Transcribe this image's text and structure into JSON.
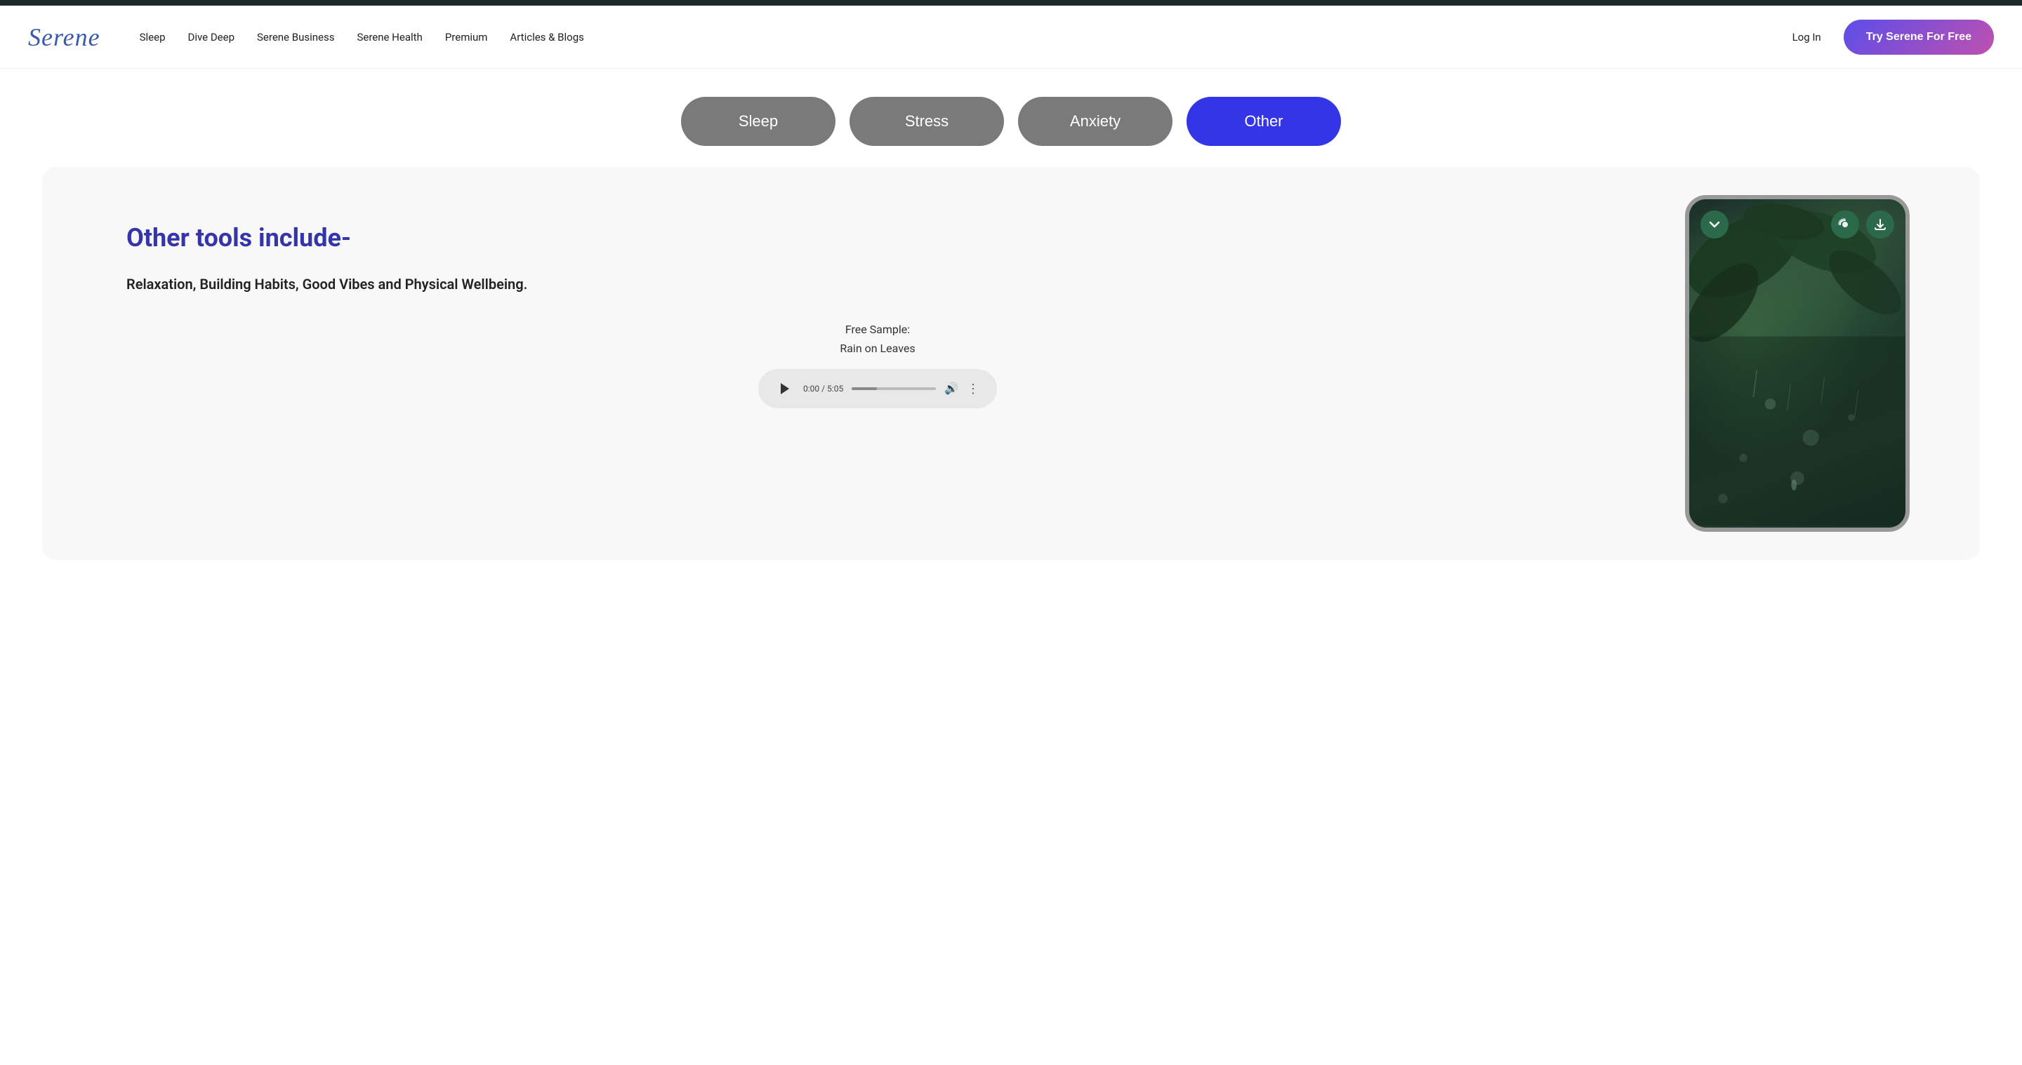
{
  "topbar": {},
  "navbar": {
    "logo": "Serene",
    "links": [
      {
        "label": "Sleep",
        "key": "sleep"
      },
      {
        "label": "Dive Deep",
        "key": "dive-deep"
      },
      {
        "label": "Serene Business",
        "key": "serene-business"
      },
      {
        "label": "Serene Health",
        "key": "serene-health"
      },
      {
        "label": "Premium",
        "key": "premium"
      },
      {
        "label": "Articles & Blogs",
        "key": "articles-blogs"
      },
      {
        "label": "Log In",
        "key": "login"
      }
    ],
    "cta_label": "Try Serene For Free"
  },
  "category_tabs": [
    {
      "label": "Sleep",
      "key": "sleep",
      "active": false
    },
    {
      "label": "Stress",
      "key": "stress",
      "active": false
    },
    {
      "label": "Anxiety",
      "key": "anxiety",
      "active": false
    },
    {
      "label": "Other",
      "key": "other",
      "active": true
    }
  ],
  "main": {
    "title": "Other tools include-",
    "description": "Relaxation, Building Habits, Good Vibes and Physical Wellbeing.",
    "free_sample_label": "Free Sample:",
    "track_name": "Rain on Leaves",
    "audio": {
      "time_current": "0:00",
      "time_total": "5:05",
      "time_display": "0:00 / 5:05"
    }
  },
  "phone": {
    "chevron_down": "❯",
    "cast_icon": "📡",
    "download_icon": "⬇"
  }
}
